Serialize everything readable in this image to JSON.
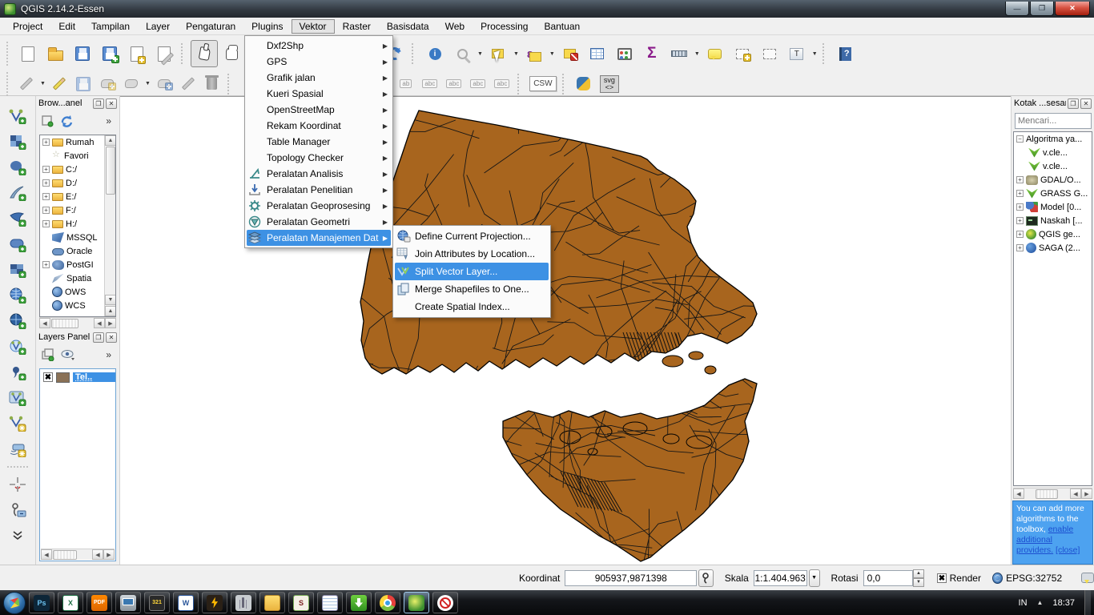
{
  "window": {
    "title": "QGIS 2.14.2-Essen"
  },
  "menubar": {
    "items": [
      {
        "label": "Project"
      },
      {
        "label": "Edit"
      },
      {
        "label": "Tampilan"
      },
      {
        "label": "Layer"
      },
      {
        "label": "Pengaturan"
      },
      {
        "label": "Plugins"
      },
      {
        "label": "Vektor"
      },
      {
        "label": "Raster"
      },
      {
        "label": "Basisdata"
      },
      {
        "label": "Web"
      },
      {
        "label": "Processing"
      },
      {
        "label": "Bantuan"
      }
    ]
  },
  "menus": {
    "vektor": {
      "items": [
        {
          "label": "Dxf2Shp"
        },
        {
          "label": "GPS"
        },
        {
          "label": "Grafik jalan"
        },
        {
          "label": "Kueri Spasial"
        },
        {
          "label": "OpenStreetMap"
        },
        {
          "label": "Rekam Koordinat"
        },
        {
          "label": "Table Manager"
        },
        {
          "label": "Topology Checker"
        },
        {
          "label": "Peralatan Analisis"
        },
        {
          "label": "Peralatan Penelitian"
        },
        {
          "label": "Peralatan Geoprosesing"
        },
        {
          "label": "Peralatan Geometri"
        },
        {
          "label": "Peralatan Manajemen Data"
        }
      ]
    },
    "manajemen_data": {
      "items": [
        {
          "label": "Define Current Projection..."
        },
        {
          "label": "Join Attributes by Location..."
        },
        {
          "label": "Split Vector Layer..."
        },
        {
          "label": "Merge Shapefiles to One..."
        },
        {
          "label": "Create Spatial Index..."
        }
      ]
    }
  },
  "browser": {
    "title": "Brow...anel",
    "items": [
      {
        "label": "Rumah"
      },
      {
        "label": "Favori"
      },
      {
        "label": "C:/"
      },
      {
        "label": "D:/"
      },
      {
        "label": "E:/"
      },
      {
        "label": "F:/"
      },
      {
        "label": "H:/"
      },
      {
        "label": "MSSQL"
      },
      {
        "label": "Oracle"
      },
      {
        "label": "PostGI"
      },
      {
        "label": "Spatia"
      },
      {
        "label": "OWS"
      },
      {
        "label": "WCS"
      }
    ]
  },
  "layers": {
    "title": "Layers Panel",
    "layer_label": "Tel.."
  },
  "toolbox": {
    "title": "Kotak ...sesan",
    "search_placeholder": "Mencari...",
    "items": [
      {
        "label": "Algoritma ya..."
      },
      {
        "label": "v.cle..."
      },
      {
        "label": "v.cle..."
      },
      {
        "label": "GDAL/O..."
      },
      {
        "label": "GRASS G..."
      },
      {
        "label": "Model [0..."
      },
      {
        "label": "Naskah [..."
      },
      {
        "label": "QGIS ge..."
      },
      {
        "label": "SAGA (2..."
      }
    ],
    "notice_text": "You can add more algorithms to the toolbox,",
    "notice_link": "enable additional providers.",
    "notice_close": "[close]"
  },
  "toolbar_text": {
    "csw": "CSW",
    "svg_top": "svg",
    "svg_bottom": "<>",
    "abc": "abc",
    "ab": "ab",
    "info_i": "i",
    "sigma": "Σ",
    "epsilon": "ε",
    "t_letter": "T",
    "question": "?"
  },
  "statusbar": {
    "koordinat_label": "Koordinat",
    "koordinat_value": "905937,9871398",
    "skala_label": "Skala",
    "skala_value": "1:1.404.963",
    "rotasi_label": "Rotasi",
    "rotasi_value": "0,0",
    "render_label": "Render",
    "epsg_label": "EPSG:32752"
  },
  "taskbar": {
    "lang": "IN",
    "time": "18:37",
    "icons": [
      {
        "name": "photoshop",
        "glyph": "Ps"
      },
      {
        "name": "excel",
        "glyph": "X"
      },
      {
        "name": "pdf-reader",
        "glyph": "PDF"
      },
      {
        "name": "presentation",
        "glyph": ""
      },
      {
        "name": "media-player-classic",
        "glyph": "321"
      },
      {
        "name": "word",
        "glyph": "W"
      },
      {
        "name": "winamp",
        "glyph": ""
      },
      {
        "name": "wireless-tool",
        "glyph": ""
      },
      {
        "name": "file-explorer",
        "glyph": ""
      },
      {
        "name": "ebook-reader",
        "glyph": "S"
      },
      {
        "name": "notepad",
        "glyph": ""
      },
      {
        "name": "idm",
        "glyph": ""
      },
      {
        "name": "chrome",
        "glyph": ""
      },
      {
        "name": "qgis",
        "glyph": ""
      },
      {
        "name": "screen-recorder",
        "glyph": ""
      }
    ]
  },
  "glyphs": {
    "minimize": "—",
    "restore": "❐",
    "close": "✕",
    "menu_arrow": "▶",
    "plus": "+",
    "minus": "−",
    "chevrons": "»",
    "dropdown": "▼",
    "left": "◀",
    "right": "▶",
    "up": "▲",
    "down": "▼",
    "check_x": "✖",
    "star": "☆",
    "tray_up": "▲"
  },
  "colors": {
    "map_fill": "#a8651e",
    "selection": "#3d91e4",
    "notice_bg": "#4da2f0",
    "taskbar_bg": "#101214"
  }
}
